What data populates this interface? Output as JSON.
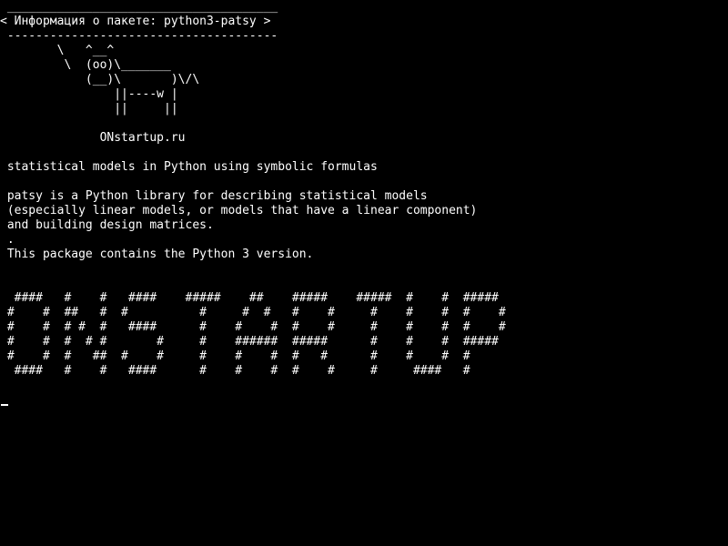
{
  "colors": {
    "background": "#000000",
    "foreground": "#ffffff"
  },
  "cowsay": {
    "border_top": " ______________________________________",
    "message": "< Информация о пакете: python3-patsy >",
    "border_bottom": " --------------------------------------",
    "cow_1": "        \\   ^__^",
    "cow_2": "         \\  (oo)\\_______",
    "cow_3": "            (__)\\       )\\/\\",
    "cow_4": "                ||----w |",
    "cow_5": "                ||     ||"
  },
  "site": "              ONstartup.ru",
  "description": {
    "summary": " statistical models in Python using symbolic formulas",
    "line_1": " patsy is a Python library for describing statistical models",
    "line_2": " (especially linear models, or models that have a linear component)",
    "line_3": " and building design matrices.",
    "dot": " .",
    "line_4": " This package contains the Python 3 version."
  },
  "banner": {
    "row_1": "  ####   #    #   ####    #####    ##    #####    #####  #    #  #####",
    "row_2": " #    #  ##   #  #          #     #  #   #    #     #    #    #  #    #",
    "row_3": " #    #  # #  #   ####      #    #    #  #    #     #    #    #  #    #",
    "row_4": " #    #  #  # #       #     #    ######  #####      #    #    #  #####",
    "row_5": " #    #  #   ##  #    #     #    #    #  #   #      #    #    #  #",
    "row_6": "  ####   #    #   ####      #    #    #  #    #     #     ####   #"
  },
  "prompt": {
    "cursor": "_"
  }
}
